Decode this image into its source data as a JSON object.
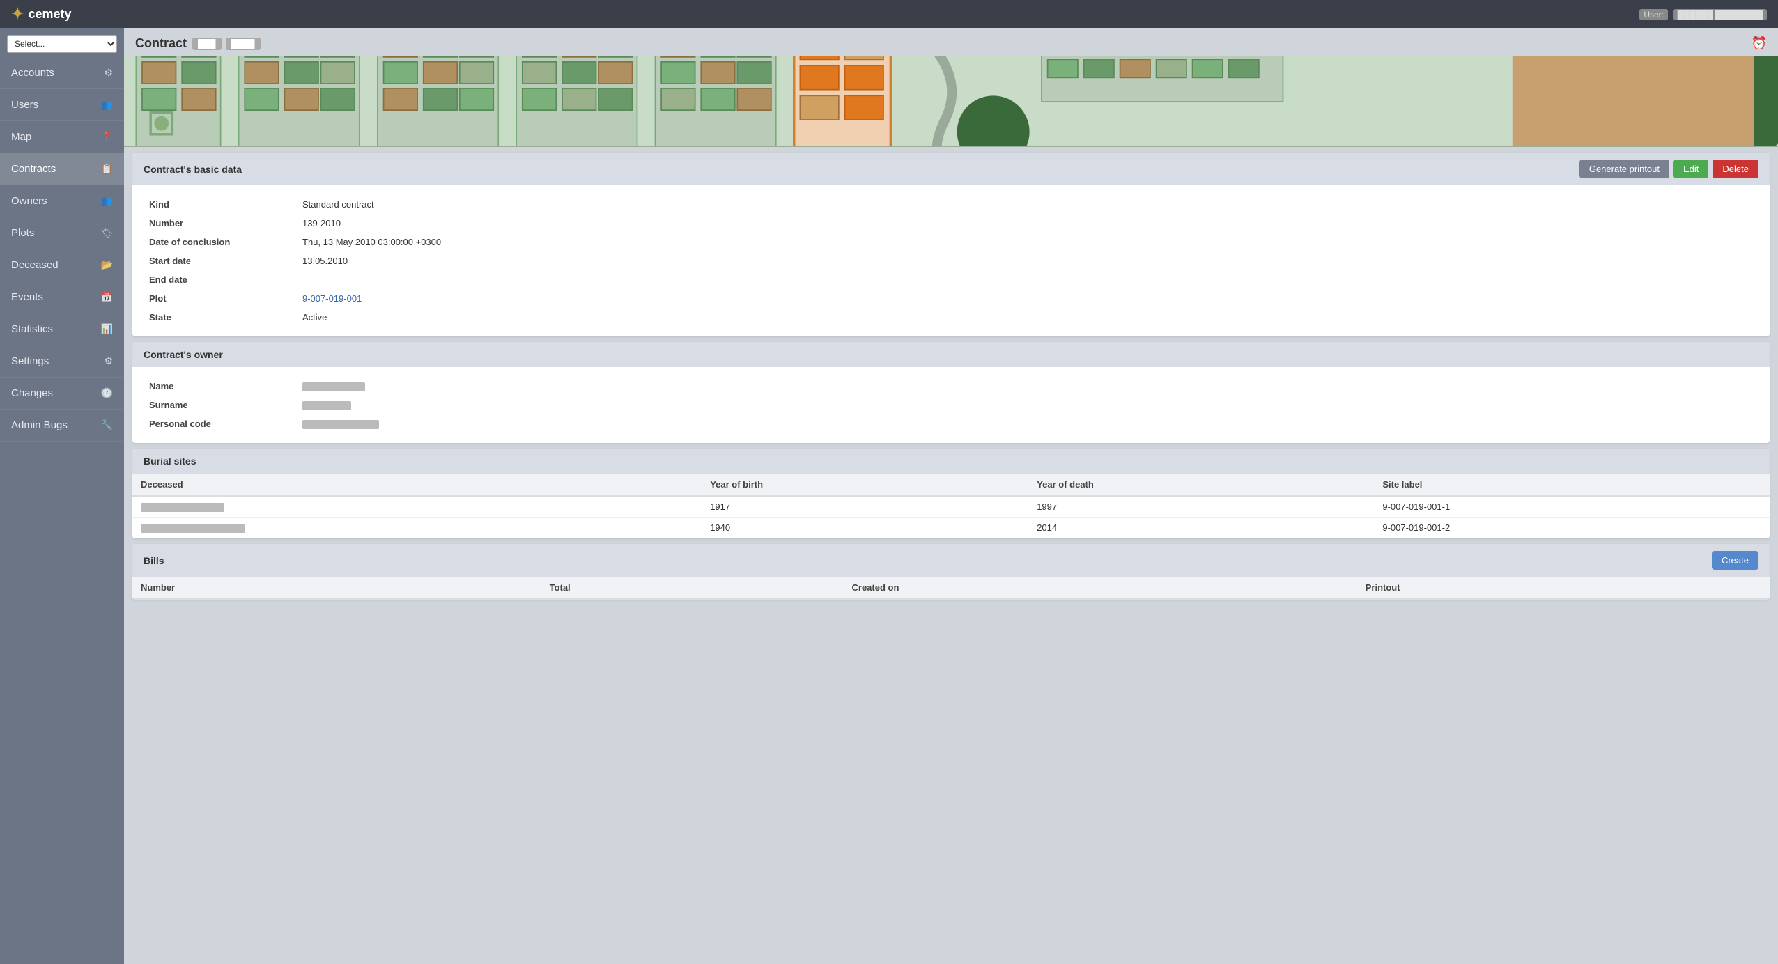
{
  "topbar": {
    "logo": "cemety",
    "logo_icon": "✦",
    "user_label": "User:",
    "user_name": "██████",
    "user_surname": "████████"
  },
  "sidebar": {
    "select_placeholder": "Select...",
    "nav_items": [
      {
        "id": "accounts",
        "label": "Accounts",
        "icon": "⚙",
        "active": false
      },
      {
        "id": "users",
        "label": "Users",
        "icon": "👥",
        "active": false
      },
      {
        "id": "map",
        "label": "Map",
        "icon": "📍",
        "active": false
      },
      {
        "id": "contracts",
        "label": "Contracts",
        "icon": "📋",
        "active": true
      },
      {
        "id": "owners",
        "label": "Owners",
        "icon": "👥",
        "active": false
      },
      {
        "id": "plots",
        "label": "Plots",
        "icon": "🏷",
        "active": false
      },
      {
        "id": "deceased",
        "label": "Deceased",
        "icon": "📂",
        "active": false
      },
      {
        "id": "events",
        "label": "Events",
        "icon": "📅",
        "active": false
      },
      {
        "id": "statistics",
        "label": "Statistics",
        "icon": "📊",
        "active": false
      },
      {
        "id": "settings",
        "label": "Settings",
        "icon": "⚙",
        "active": false
      },
      {
        "id": "changes",
        "label": "Changes",
        "icon": "🕐",
        "active": false
      },
      {
        "id": "admin-bugs",
        "label": "Admin Bugs",
        "icon": "🔧",
        "active": false
      }
    ]
  },
  "page": {
    "title": "Contract",
    "badge1": "███",
    "badge2": "████",
    "clock_icon": "⏰"
  },
  "contract_basic": {
    "section_title": "Contract's basic data",
    "btn_generate": "Generate printout",
    "btn_edit": "Edit",
    "btn_delete": "Delete",
    "fields": [
      {
        "label": "Kind",
        "value": "Standard contract",
        "is_link": false
      },
      {
        "label": "Number",
        "value": "139-2010",
        "is_link": false
      },
      {
        "label": "Date of conclusion",
        "value": "Thu, 13 May 2010 03:00:00 +0300",
        "is_link": false
      },
      {
        "label": "Start date",
        "value": "13.05.2010",
        "is_link": false
      },
      {
        "label": "End date",
        "value": "",
        "is_link": false
      },
      {
        "label": "Plot",
        "value": "9-007-019-001",
        "is_link": true
      },
      {
        "label": "State",
        "value": "Active",
        "is_link": false
      }
    ]
  },
  "contract_owner": {
    "section_title": "Contract's owner",
    "fields": [
      {
        "label": "Name",
        "blurred": true,
        "blur_width": 90
      },
      {
        "label": "Surname",
        "blurred": true,
        "blur_width": 70
      },
      {
        "label": "Personal code",
        "blurred": true,
        "blur_width": 110
      }
    ]
  },
  "burial_sites": {
    "section_title": "Burial sites",
    "columns": [
      "Deceased",
      "Year of birth",
      "Year of death",
      "Site label"
    ],
    "rows": [
      {
        "deceased": "blurred1",
        "year_birth": "1917",
        "year_death": "1997",
        "site_label": "9-007-019-001-1"
      },
      {
        "deceased": "blurred2",
        "year_birth": "1940",
        "year_death": "2014",
        "site_label": "9-007-019-001-2"
      }
    ]
  },
  "bills": {
    "section_title": "Bills",
    "btn_create": "Create",
    "columns": [
      "Number",
      "Total",
      "Created on",
      "Printout"
    ]
  }
}
